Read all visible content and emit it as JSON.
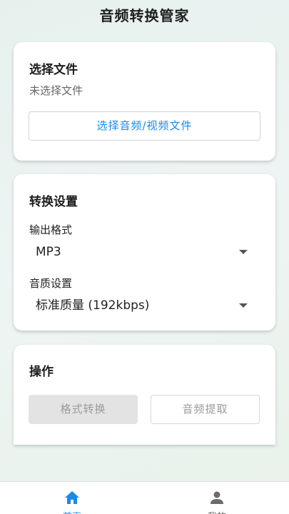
{
  "app": {
    "title": "音频转换管家"
  },
  "file_card": {
    "title": "选择文件",
    "status": "未选择文件",
    "select_button": "选择音频/视频文件"
  },
  "settings_card": {
    "title": "转换设置",
    "format_label": "输出格式",
    "format_value": "MP3",
    "quality_label": "音质设置",
    "quality_value": "标准质量 (192kbps)"
  },
  "ops_card": {
    "title": "操作",
    "convert_button": "格式转换",
    "extract_button": "音频提取"
  },
  "bottom_nav": {
    "items": [
      {
        "label": "首页",
        "icon": "home-icon",
        "active": true
      },
      {
        "label": "我的",
        "icon": "person-icon",
        "active": false
      }
    ]
  },
  "colors": {
    "accent": "#1e88e5",
    "disabled_bg": "#e3e3e3",
    "disabled_text": "#9a9a9a"
  }
}
